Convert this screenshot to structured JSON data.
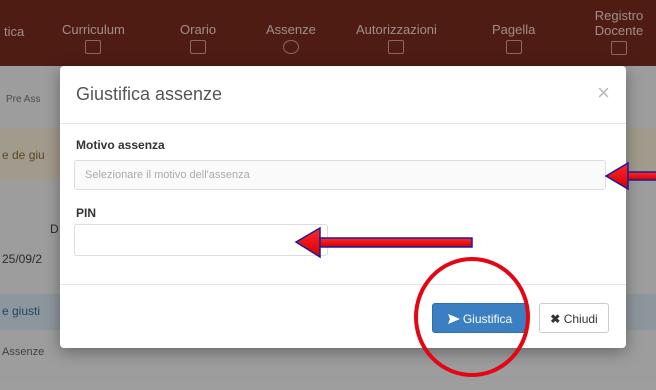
{
  "nav": {
    "items": [
      {
        "label": "tica"
      },
      {
        "label": "Curriculum"
      },
      {
        "label": "Orario"
      },
      {
        "label": "Assenze"
      },
      {
        "label": "Autorizzazioni"
      },
      {
        "label": "Pagella"
      },
      {
        "label": "Registro Docente"
      }
    ]
  },
  "background": {
    "crumbs": "Pre  Ass",
    "row1": "e de giu",
    "row2_date": "25/09/2",
    "row2_letter": "D",
    "row3": "e giusti",
    "row4": "Assenze"
  },
  "modal": {
    "title": "Giustifica assenze",
    "close_symbol": "×",
    "reason_label": "Motivo assenza",
    "reason_placeholder": "Selezionare il motivo dell'assenza",
    "pin_label": "PIN",
    "pin_value": "",
    "justify_label": "Giustifica",
    "close_label": "Chiudi"
  },
  "colors": {
    "navbar": "#7a2c1f",
    "primary": "#3a7fc1",
    "annotation": "#e30613"
  }
}
